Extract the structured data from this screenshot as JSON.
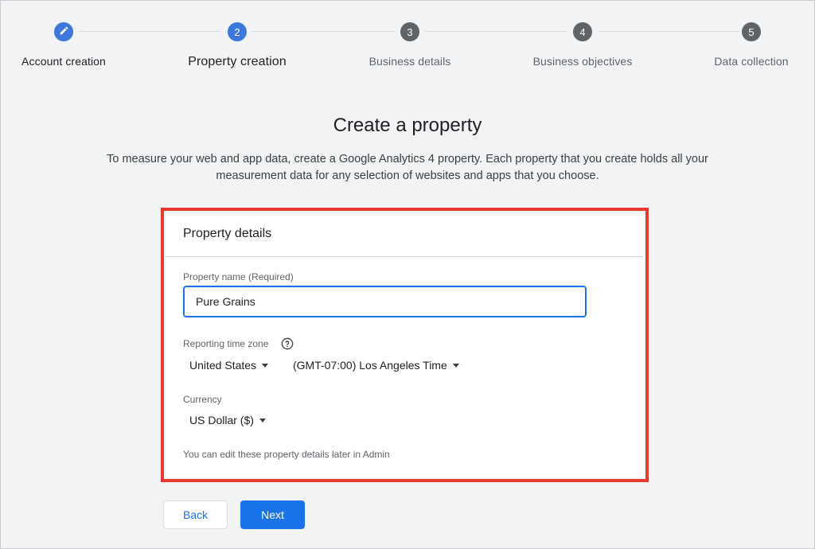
{
  "stepper": {
    "steps": [
      {
        "number": "",
        "label": "Account creation",
        "state": "done",
        "icon": "pencil-icon"
      },
      {
        "number": "2",
        "label": "Property creation",
        "state": "current"
      },
      {
        "number": "3",
        "label": "Business details",
        "state": "upcoming"
      },
      {
        "number": "4",
        "label": "Business objectives",
        "state": "upcoming"
      },
      {
        "number": "5",
        "label": "Data collection",
        "state": "upcoming"
      }
    ]
  },
  "main": {
    "title": "Create a property",
    "intro_line1": "To measure your web and app data, create a Google Analytics 4 property. Each property that you create holds all your",
    "intro_line2": "measurement data for any selection of websites and apps that you choose."
  },
  "card": {
    "title": "Property details",
    "property_name_label": "Property name (Required)",
    "property_name_value": "Pure Grains",
    "time_zone_label": "Reporting time zone",
    "country_value": "United States",
    "time_zone_value": "(GMT-07:00) Los Angeles Time",
    "currency_label": "Currency",
    "currency_value": "US Dollar ($)",
    "footnote": "You can edit these property details later in Admin"
  },
  "actions": {
    "back_label": "Back",
    "next_label": "Next"
  },
  "colors": {
    "accent": "#1a73e8",
    "step_active": "#3c78dc",
    "step_inactive": "#5f6368",
    "highlight": "#e53a2c"
  }
}
